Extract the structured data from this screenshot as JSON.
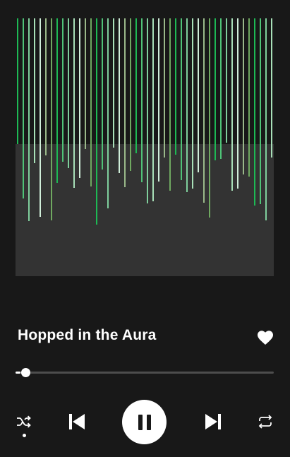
{
  "track": {
    "title": "Hopped in the Aura",
    "liked": true,
    "progress_fraction": 0.02
  },
  "artwork": {
    "background_color": "#333333",
    "line_colors": [
      "#1db954",
      "#4fc377",
      "#7fcf9c",
      "#a8e0b8",
      "#cfeed9",
      "#9ab98a",
      "#6fa860"
    ]
  },
  "controls": {
    "shuffle_icon": "shuffle-icon",
    "shuffle_active": true,
    "previous_icon": "skip-previous-icon",
    "play_state": "playing",
    "pause_icon": "pause-icon",
    "next_icon": "skip-next-icon",
    "repeat_icon": "repeat-icon",
    "like_icon": "heart-icon"
  },
  "colors": {
    "background": "#181818",
    "foreground": "#ffffff",
    "progress_track": "#4d4d4d"
  }
}
